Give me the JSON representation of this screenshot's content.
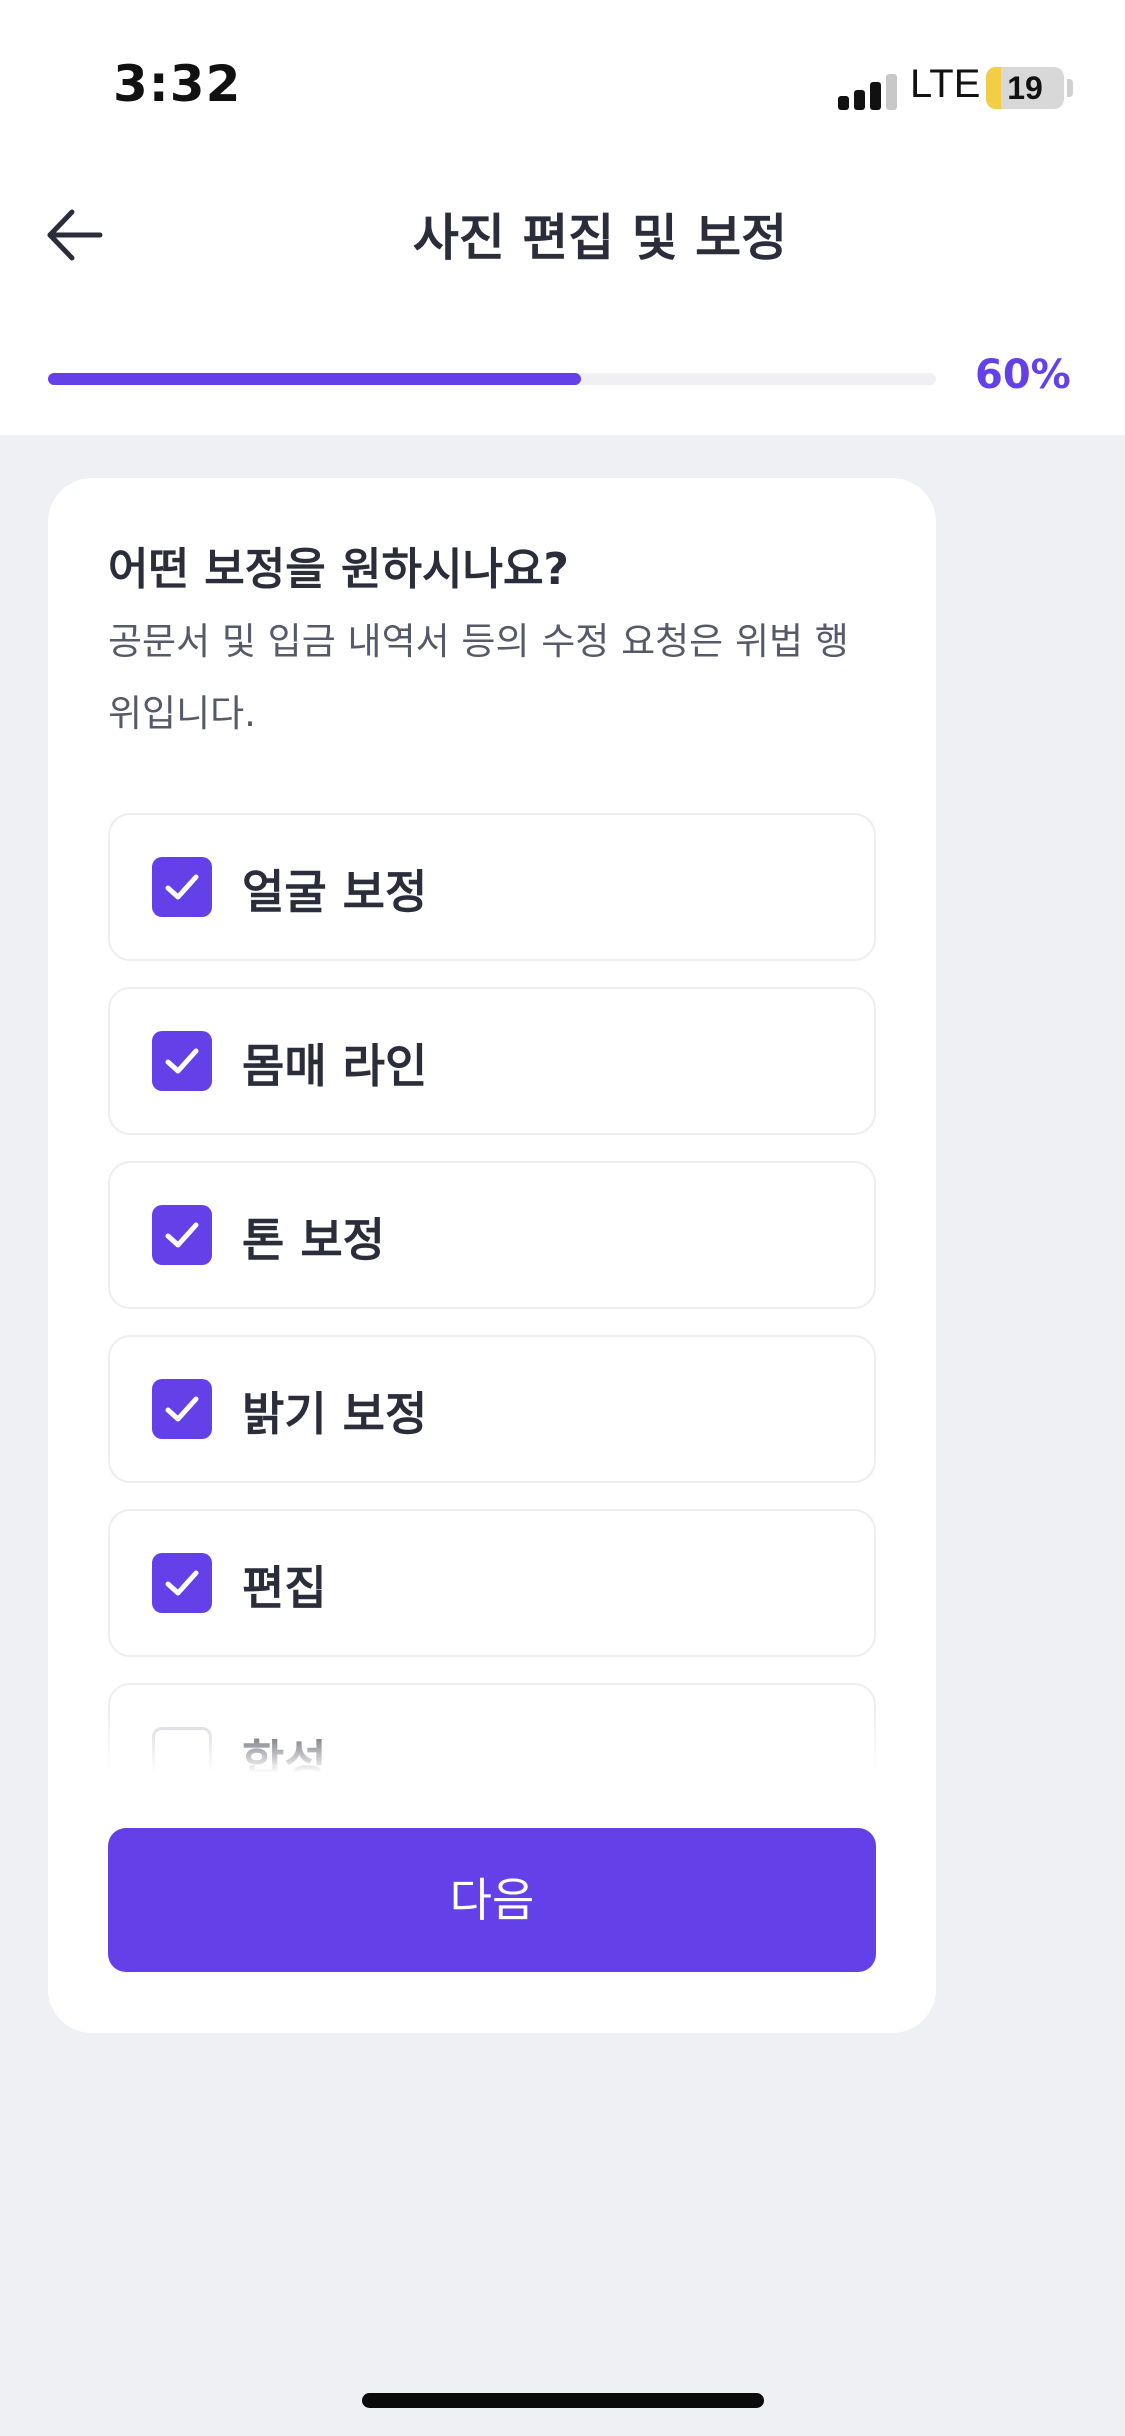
{
  "status_bar": {
    "time": "3:32",
    "network": "LTE",
    "battery": "19",
    "battery_level": 0.19,
    "signal_bars": 3
  },
  "header": {
    "title": "사진 편집 및 보정",
    "back_icon": "arrow-left-icon"
  },
  "progress": {
    "value": 0.6,
    "label": "60%"
  },
  "card": {
    "question": "어떤 보정을 원하시나요?",
    "subtext": "공문서 및 입금 내역서 등의 수정 요청은 위법 행위입니다.",
    "options": [
      {
        "label": "얼굴 보정",
        "checked": true
      },
      {
        "label": "몸매 라인",
        "checked": true
      },
      {
        "label": "톤 보정",
        "checked": true
      },
      {
        "label": "밝기 보정",
        "checked": true
      },
      {
        "label": "편집",
        "checked": true
      },
      {
        "label": "합성",
        "checked": false
      }
    ],
    "next_label": "다음"
  },
  "colors": {
    "accent": "#6340e8",
    "background": "#eff0f4",
    "text": "#2b2e3a",
    "battery_fill": "#f2cd46"
  }
}
